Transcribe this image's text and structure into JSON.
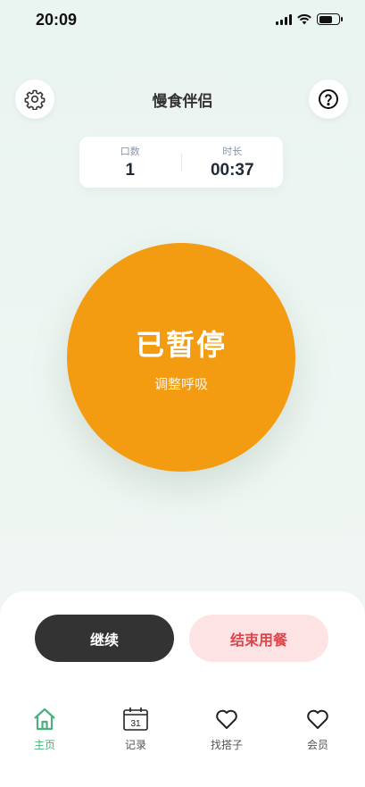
{
  "status_bar": {
    "time": "20:09"
  },
  "header": {
    "title": "慢食伴侣",
    "settings_icon": "gear-icon",
    "help_icon": "question-icon"
  },
  "stats": {
    "bites_label": "口数",
    "bites_value": "1",
    "duration_label": "时长",
    "duration_value": "00:37"
  },
  "main": {
    "status": "已暂停",
    "hint": "调整呼吸",
    "color": "#f39c12"
  },
  "actions": {
    "continue_label": "继续",
    "end_label": "结束用餐"
  },
  "tabs": [
    {
      "label": "主页",
      "icon": "home-icon",
      "active": true
    },
    {
      "label": "记录",
      "icon": "calendar-icon",
      "calendar_day": "31"
    },
    {
      "label": "找搭子",
      "icon": "heart-icon"
    },
    {
      "label": "会员",
      "icon": "heart-icon"
    }
  ],
  "colors": {
    "accent": "#4caf7d",
    "primary": "#f39c12",
    "danger": "#e0454a"
  }
}
